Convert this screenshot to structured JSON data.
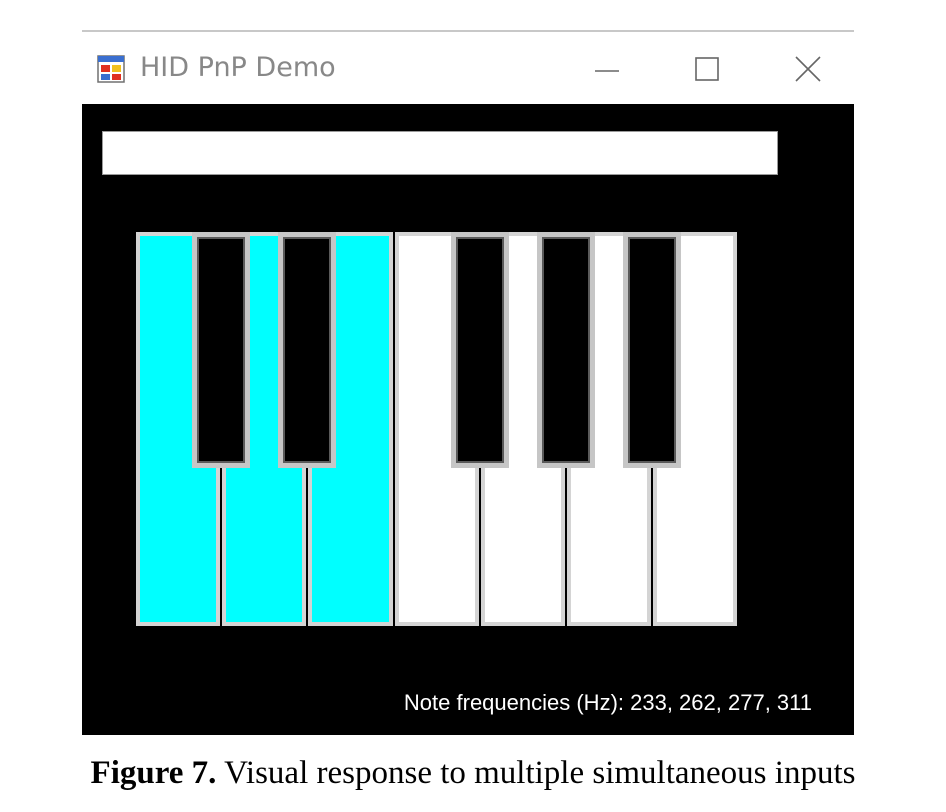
{
  "window": {
    "title": "HID PnP Demo",
    "icon": "app-window-icon",
    "controls": [
      {
        "name": "minimize",
        "icon": "minimize-icon"
      },
      {
        "name": "maximize",
        "icon": "maximize-icon"
      },
      {
        "name": "close",
        "icon": "close-icon"
      }
    ]
  },
  "text_field": {
    "value": ""
  },
  "keyboard": {
    "white_keys": [
      {
        "pressed": true
      },
      {
        "pressed": true
      },
      {
        "pressed": true
      },
      {
        "pressed": false
      },
      {
        "pressed": false
      },
      {
        "pressed": false
      },
      {
        "pressed": false
      }
    ],
    "black_key_count": 5,
    "pressed_color": "#00ffff",
    "white_color": "#ffffff",
    "black_color": "#000000"
  },
  "status": {
    "text": "Note frequencies (Hz): 233, 262, 277, 311"
  },
  "caption": {
    "label": "Figure 7.",
    "text": " Visual response to multiple simultaneous inputs"
  }
}
